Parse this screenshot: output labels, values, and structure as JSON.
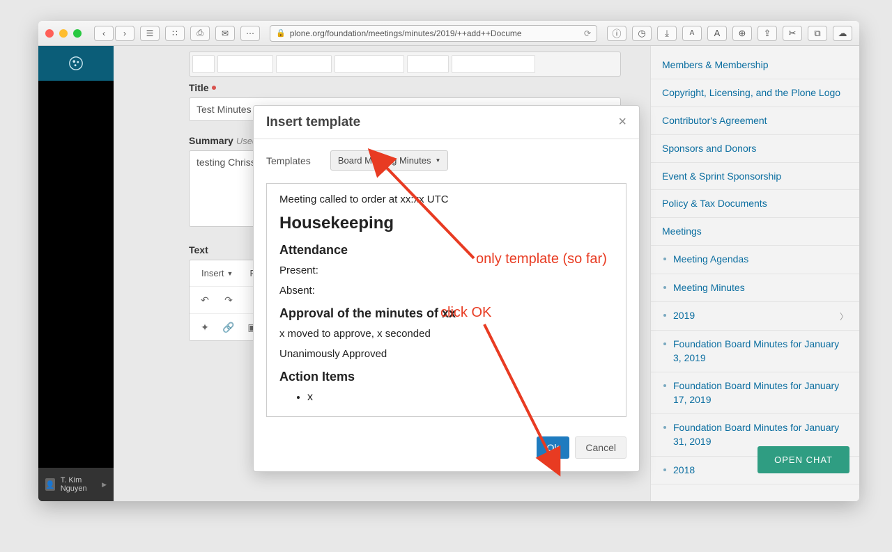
{
  "browser": {
    "url": "plone.org/foundation/meetings/minutes/2019/++add++Docume"
  },
  "form": {
    "title_label": "Title",
    "title_value": "Test Minutes",
    "summary_label": "Summary",
    "summary_hint": "Used",
    "summary_value": "testing Chriss",
    "text_label": "Text",
    "insert_btn": "Insert",
    "format_btn": "Fo"
  },
  "sidebar": {
    "links": [
      "Members & Membership",
      "Copyright, Licensing, and the Plone Logo",
      "Contributor's Agreement",
      "Sponsors and Donors",
      "Event & Sprint Sponsorship",
      "Policy & Tax Documents",
      "Meetings"
    ],
    "sub": [
      "Meeting Agendas",
      "Meeting Minutes",
      "2019",
      "Foundation Board Minutes for January 3, 2019",
      "Foundation Board Minutes for January 17, 2019",
      "Foundation Board Minutes for January 31, 2019",
      "2018"
    ]
  },
  "modal": {
    "title": "Insert template",
    "templates_label": "Templates",
    "selected_template": "Board Meeting Minutes",
    "ok": "Ok",
    "cancel": "Cancel",
    "preview": {
      "called": "Meeting called to order at xx:xx UTC",
      "h_housekeeping": "Housekeeping",
      "h_attendance": "Attendance",
      "present": "Present:",
      "absent": "Absent:",
      "h_approval": "Approval of the minutes of xx",
      "moved": "x moved to approve, x seconded",
      "approved": "Unanimously Approved",
      "h_action": "Action Items",
      "action_item": "x"
    }
  },
  "annotations": {
    "only_template": "only template (so far)",
    "click_ok": "click OK"
  },
  "user": {
    "name": "T. Kim Nguyen"
  },
  "chat": {
    "label": "OPEN CHAT"
  }
}
